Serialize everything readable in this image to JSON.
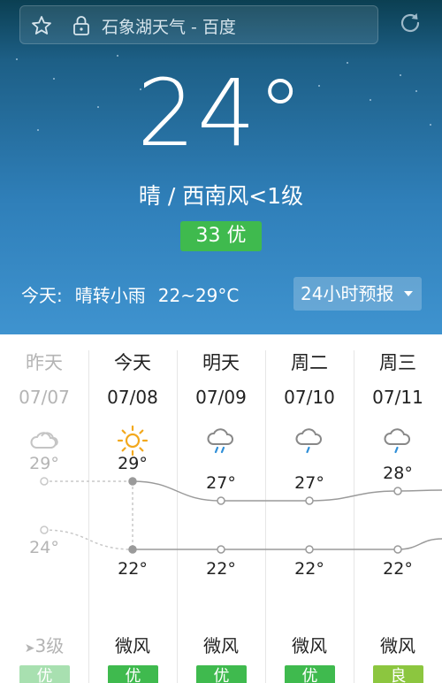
{
  "browser": {
    "url_text": "石象湖天气 - 百度"
  },
  "current": {
    "temperature": "24°",
    "condition": "晴  /  西南风<1级",
    "aqi": "33 优",
    "today_label": "今天:",
    "today_weather": "晴转小雨",
    "today_range": "22~29°C",
    "hourly_button": "24小时预报"
  },
  "colors": {
    "aqi_good": "#3fba4e",
    "aqi_moderate": "#8cc63f",
    "aqi_good_past": "#a8e0b0"
  },
  "forecast": [
    {
      "day": "昨天",
      "date": "07/07",
      "icon": "cloudy-icon",
      "high": "29°",
      "low": "24°",
      "wind": "3级",
      "aq": "优",
      "past": true
    },
    {
      "day": "今天",
      "date": "07/08",
      "icon": "sunny-icon",
      "high": "29°",
      "low": "22°",
      "wind": "微风",
      "aq": "优",
      "past": false
    },
    {
      "day": "明天",
      "date": "07/09",
      "icon": "light-rain-icon",
      "high": "27°",
      "low": "22°",
      "wind": "微风",
      "aq": "优",
      "past": false
    },
    {
      "day": "周二",
      "date": "07/10",
      "icon": "light-rain-icon",
      "high": "27°",
      "low": "22°",
      "wind": "微风",
      "aq": "优",
      "past": false
    },
    {
      "day": "周三",
      "date": "07/11",
      "icon": "light-rain-icon",
      "high": "28°",
      "low": "22°",
      "wind": "微风",
      "aq": "良",
      "past": false
    }
  ],
  "chart_data": {
    "type": "line",
    "categories": [
      "07/07",
      "07/08",
      "07/09",
      "07/10",
      "07/11"
    ],
    "series": [
      {
        "values": [
          29,
          29,
          27,
          27,
          28
        ]
      },
      {
        "values": [
          24,
          22,
          22,
          22,
          22
        ]
      }
    ]
  }
}
